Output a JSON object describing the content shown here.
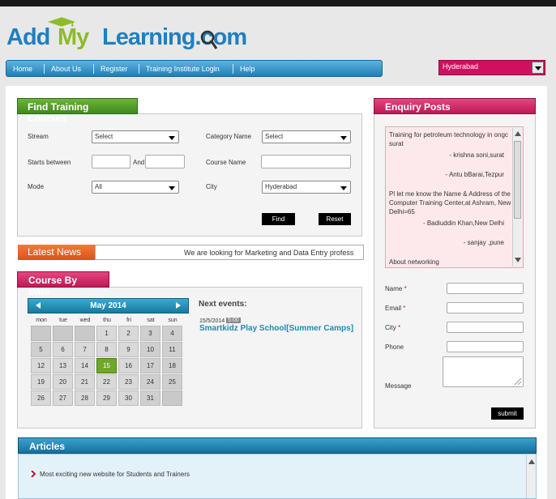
{
  "header": {
    "logo_part1": "Add",
    "logo_part2": "My",
    "logo_part3": "Learning.com",
    "logo_text": "AddMyLearning.com"
  },
  "nav": {
    "items": [
      "Home",
      "About Us",
      "Register",
      "Training Institute Login",
      "Help"
    ]
  },
  "city_selector": {
    "value": "Hyderabad"
  },
  "find_courses": {
    "title": "Find Training Courses",
    "stream_label": "Stream",
    "stream_value": "Select",
    "category_label": "Category Name",
    "category_value": "Select",
    "starts_label": "Starts between",
    "and_label": "And",
    "course_label": "Course Name",
    "mode_label": "Mode",
    "mode_value": "All",
    "city_label": "City",
    "city_value": "Hyderabad",
    "find_button": "Find",
    "reset_button": "Reset"
  },
  "latest_news": {
    "title": "Latest News",
    "ticker": "We are looking for Marketing and Data Entry profess"
  },
  "course_by_date": {
    "title": "Course By Date",
    "month": "May 2014",
    "weekdays": [
      "mon",
      "tue",
      "wed",
      "thu",
      "fri",
      "sat",
      "sun"
    ],
    "today": 15,
    "next_events_label": "Next events:",
    "event_date": "15/5/2014",
    "event_time": "5:00",
    "event_title": "Smartkidz Play School[Summer Camps]"
  },
  "enquiry": {
    "title": "Enquiry Posts",
    "posts": [
      "Training for petroleum technology in ongc",
      "surat",
      "- krishna soni,surat",
      "- Antu bBarai,Tezpur",
      "Pl let me know the Name & Address of the",
      "Computer Training Center,at Ashram, New",
      "Delhi=65",
      "- Badiuddin Khan,New Delhi",
      "- sanjay ,pune",
      "About networking"
    ],
    "name_label": "Name",
    "email_label": "Email",
    "city_label": "City",
    "phone_label": "Phone",
    "message_label": "Message",
    "required_mark": "*",
    "submit_button": "submit"
  },
  "articles": {
    "title": "Articles",
    "items": [
      "Most exciting new website for Students and Trainers"
    ]
  },
  "colors": {
    "nav_blue": "#1f7fb5",
    "green": "#3e8a1c",
    "pink": "#bd1958",
    "orange": "#d9531a",
    "cal_today": "#6fa828"
  }
}
